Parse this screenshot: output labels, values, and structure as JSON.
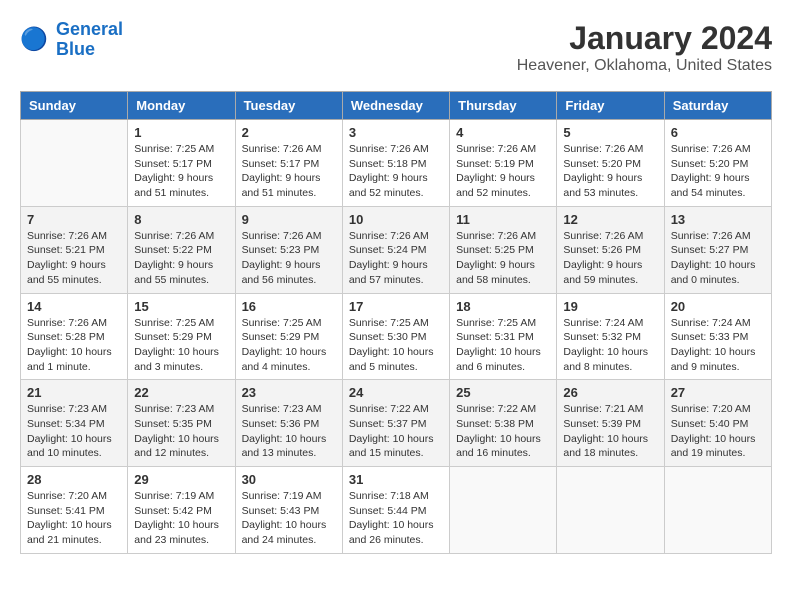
{
  "logo": {
    "line1": "General",
    "line2": "Blue"
  },
  "title": "January 2024",
  "subtitle": "Heavener, Oklahoma, United States",
  "columns": [
    "Sunday",
    "Monday",
    "Tuesday",
    "Wednesday",
    "Thursday",
    "Friday",
    "Saturday"
  ],
  "weeks": [
    [
      {
        "day": "",
        "info": ""
      },
      {
        "day": "1",
        "info": "Sunrise: 7:25 AM\nSunset: 5:17 PM\nDaylight: 9 hours\nand 51 minutes."
      },
      {
        "day": "2",
        "info": "Sunrise: 7:26 AM\nSunset: 5:17 PM\nDaylight: 9 hours\nand 51 minutes."
      },
      {
        "day": "3",
        "info": "Sunrise: 7:26 AM\nSunset: 5:18 PM\nDaylight: 9 hours\nand 52 minutes."
      },
      {
        "day": "4",
        "info": "Sunrise: 7:26 AM\nSunset: 5:19 PM\nDaylight: 9 hours\nand 52 minutes."
      },
      {
        "day": "5",
        "info": "Sunrise: 7:26 AM\nSunset: 5:20 PM\nDaylight: 9 hours\nand 53 minutes."
      },
      {
        "day": "6",
        "info": "Sunrise: 7:26 AM\nSunset: 5:20 PM\nDaylight: 9 hours\nand 54 minutes."
      }
    ],
    [
      {
        "day": "7",
        "info": "Sunrise: 7:26 AM\nSunset: 5:21 PM\nDaylight: 9 hours\nand 55 minutes."
      },
      {
        "day": "8",
        "info": "Sunrise: 7:26 AM\nSunset: 5:22 PM\nDaylight: 9 hours\nand 55 minutes."
      },
      {
        "day": "9",
        "info": "Sunrise: 7:26 AM\nSunset: 5:23 PM\nDaylight: 9 hours\nand 56 minutes."
      },
      {
        "day": "10",
        "info": "Sunrise: 7:26 AM\nSunset: 5:24 PM\nDaylight: 9 hours\nand 57 minutes."
      },
      {
        "day": "11",
        "info": "Sunrise: 7:26 AM\nSunset: 5:25 PM\nDaylight: 9 hours\nand 58 minutes."
      },
      {
        "day": "12",
        "info": "Sunrise: 7:26 AM\nSunset: 5:26 PM\nDaylight: 9 hours\nand 59 minutes."
      },
      {
        "day": "13",
        "info": "Sunrise: 7:26 AM\nSunset: 5:27 PM\nDaylight: 10 hours\nand 0 minutes."
      }
    ],
    [
      {
        "day": "14",
        "info": "Sunrise: 7:26 AM\nSunset: 5:28 PM\nDaylight: 10 hours\nand 1 minute."
      },
      {
        "day": "15",
        "info": "Sunrise: 7:25 AM\nSunset: 5:29 PM\nDaylight: 10 hours\nand 3 minutes."
      },
      {
        "day": "16",
        "info": "Sunrise: 7:25 AM\nSunset: 5:29 PM\nDaylight: 10 hours\nand 4 minutes."
      },
      {
        "day": "17",
        "info": "Sunrise: 7:25 AM\nSunset: 5:30 PM\nDaylight: 10 hours\nand 5 minutes."
      },
      {
        "day": "18",
        "info": "Sunrise: 7:25 AM\nSunset: 5:31 PM\nDaylight: 10 hours\nand 6 minutes."
      },
      {
        "day": "19",
        "info": "Sunrise: 7:24 AM\nSunset: 5:32 PM\nDaylight: 10 hours\nand 8 minutes."
      },
      {
        "day": "20",
        "info": "Sunrise: 7:24 AM\nSunset: 5:33 PM\nDaylight: 10 hours\nand 9 minutes."
      }
    ],
    [
      {
        "day": "21",
        "info": "Sunrise: 7:23 AM\nSunset: 5:34 PM\nDaylight: 10 hours\nand 10 minutes."
      },
      {
        "day": "22",
        "info": "Sunrise: 7:23 AM\nSunset: 5:35 PM\nDaylight: 10 hours\nand 12 minutes."
      },
      {
        "day": "23",
        "info": "Sunrise: 7:23 AM\nSunset: 5:36 PM\nDaylight: 10 hours\nand 13 minutes."
      },
      {
        "day": "24",
        "info": "Sunrise: 7:22 AM\nSunset: 5:37 PM\nDaylight: 10 hours\nand 15 minutes."
      },
      {
        "day": "25",
        "info": "Sunrise: 7:22 AM\nSunset: 5:38 PM\nDaylight: 10 hours\nand 16 minutes."
      },
      {
        "day": "26",
        "info": "Sunrise: 7:21 AM\nSunset: 5:39 PM\nDaylight: 10 hours\nand 18 minutes."
      },
      {
        "day": "27",
        "info": "Sunrise: 7:20 AM\nSunset: 5:40 PM\nDaylight: 10 hours\nand 19 minutes."
      }
    ],
    [
      {
        "day": "28",
        "info": "Sunrise: 7:20 AM\nSunset: 5:41 PM\nDaylight: 10 hours\nand 21 minutes."
      },
      {
        "day": "29",
        "info": "Sunrise: 7:19 AM\nSunset: 5:42 PM\nDaylight: 10 hours\nand 23 minutes."
      },
      {
        "day": "30",
        "info": "Sunrise: 7:19 AM\nSunset: 5:43 PM\nDaylight: 10 hours\nand 24 minutes."
      },
      {
        "day": "31",
        "info": "Sunrise: 7:18 AM\nSunset: 5:44 PM\nDaylight: 10 hours\nand 26 minutes."
      },
      {
        "day": "",
        "info": ""
      },
      {
        "day": "",
        "info": ""
      },
      {
        "day": "",
        "info": ""
      }
    ]
  ]
}
